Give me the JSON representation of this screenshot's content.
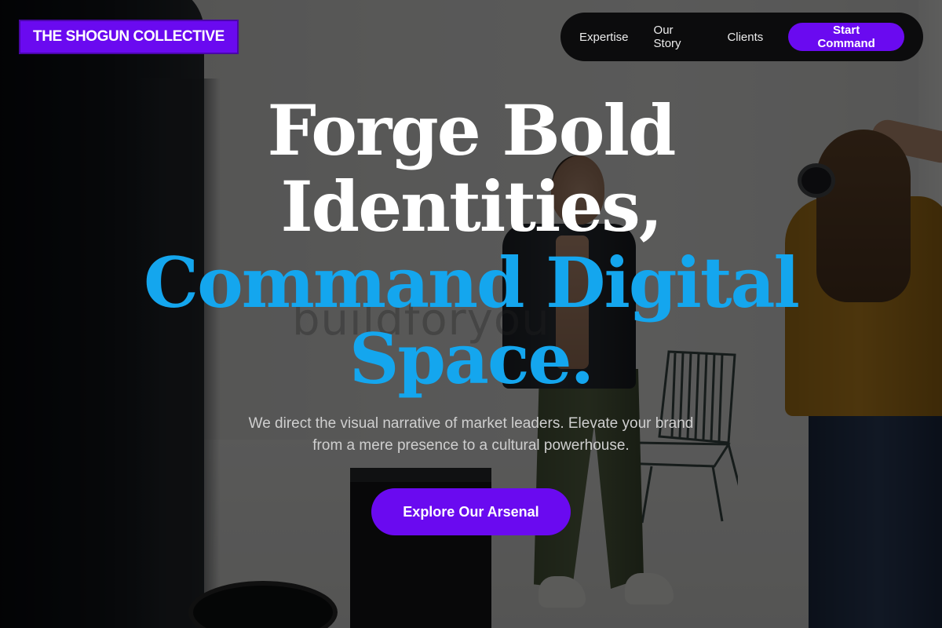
{
  "brand": {
    "logo_text": "THE SHOGUN COLLECTIVE"
  },
  "nav": {
    "links": [
      "Expertise",
      "Our Story",
      "Clients"
    ],
    "cta_label": "Start Command"
  },
  "hero": {
    "headline_white_line1": "Forge Bold",
    "headline_white_line2": "Identities,",
    "headline_blue_line1": "Command Digital",
    "headline_blue_line2": "Space.",
    "subtext_line1": "We direct the visual narrative of market leaders. Elevate your brand",
    "subtext_line2": "from a mere presence to a cultural powerhouse.",
    "cta_label": "Explore Our Arsenal",
    "background_watermark": "buildforyou"
  },
  "colors": {
    "accent_purple": "#6a0af0",
    "headline_blue": "#14a6ee",
    "nav_bg": "#0c0c0d"
  }
}
